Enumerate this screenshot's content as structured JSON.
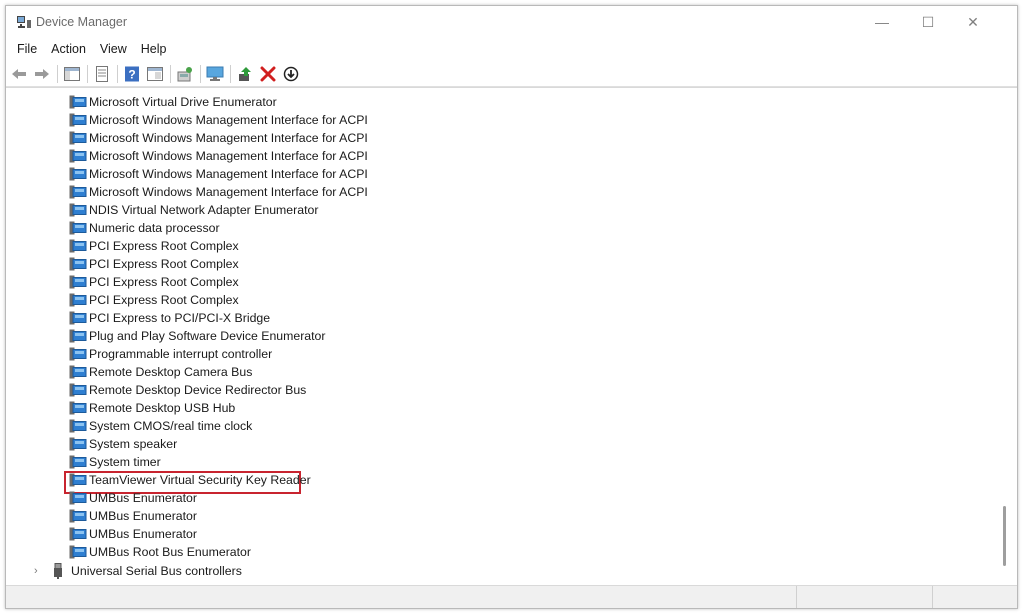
{
  "window": {
    "title": "Device Manager"
  },
  "controls": {
    "minimize": "—",
    "maximize": "☐",
    "close": "✕"
  },
  "menu": [
    "File",
    "Action",
    "View",
    "Help"
  ],
  "toolbar": {
    "buttons": [
      "back-icon",
      "forward-icon",
      "sep",
      "console-tree-icon",
      "sep",
      "properties-icon",
      "sep",
      "help-icon",
      "device-view-icon",
      "sep",
      "scan-hardware-icon",
      "sep",
      "monitor-icon",
      "sep",
      "update-driver-icon",
      "uninstall-icon",
      "disable-device-icon"
    ]
  },
  "devices": [
    "Microsoft Virtual Drive Enumerator",
    "Microsoft Windows Management Interface for ACPI",
    "Microsoft Windows Management Interface for ACPI",
    "Microsoft Windows Management Interface for ACPI",
    "Microsoft Windows Management Interface for ACPI",
    "Microsoft Windows Management Interface for ACPI",
    "NDIS Virtual Network Adapter Enumerator",
    "Numeric data processor",
    "PCI Express Root Complex",
    "PCI Express Root Complex",
    "PCI Express Root Complex",
    "PCI Express Root Complex",
    "PCI Express to PCI/PCI-X Bridge",
    "Plug and Play Software Device Enumerator",
    "Programmable interrupt controller",
    "Remote Desktop Camera Bus",
    "Remote Desktop Device Redirector Bus",
    "Remote Desktop USB Hub",
    "System CMOS/real time clock",
    "System speaker",
    "System timer",
    "TeamViewer Virtual Security Key Reader",
    "UMBus Enumerator",
    "UMBus Enumerator",
    "UMBus Enumerator",
    "UMBus Root Bus Enumerator"
  ],
  "highlighted_device": "TeamViewer Virtual Security Key Reader",
  "category": {
    "label": "Universal Serial Bus controllers",
    "expanded": false,
    "icon": "usb-plug-icon"
  },
  "colors": {
    "highlight": "#c8242f",
    "device_icon": "#2f7fd1"
  }
}
